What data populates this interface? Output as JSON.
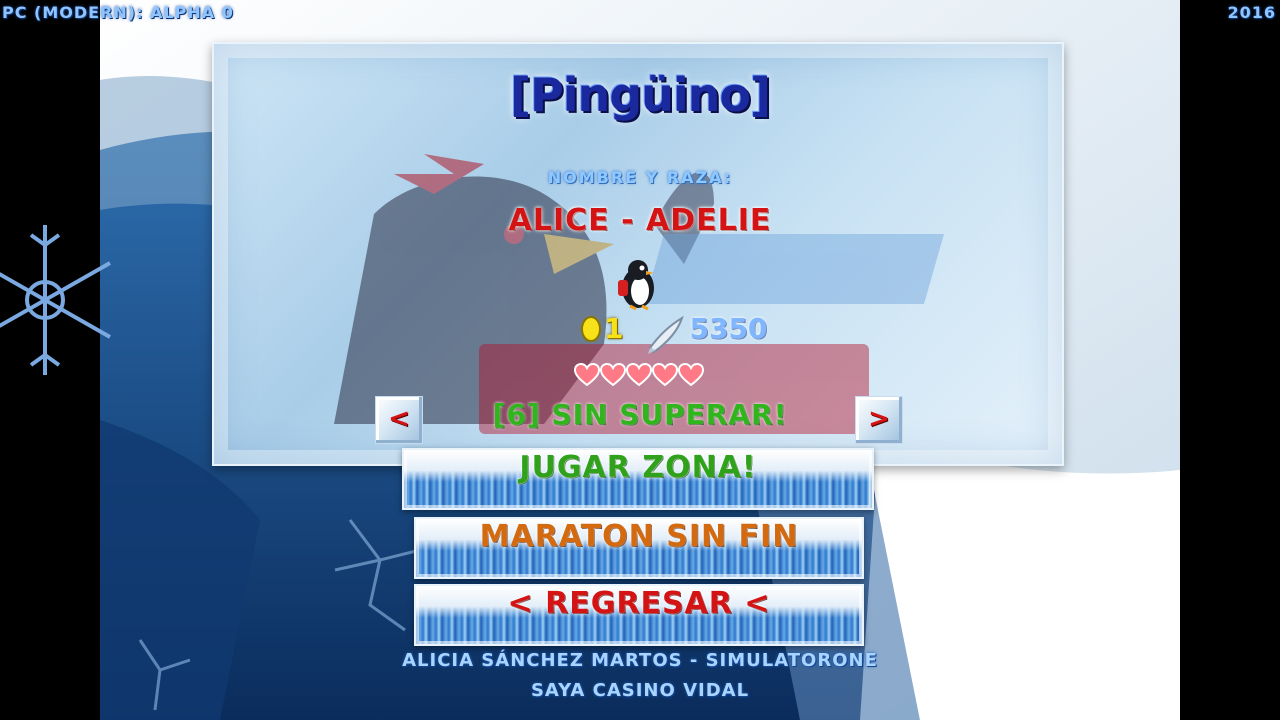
{
  "header": {
    "platform_label": "PC (MODERN): ALPHA 0",
    "year": "2016"
  },
  "panel": {
    "title": "[Pingüino]",
    "name_label": "NOMBRE Y RAZA:",
    "name_value": "ALICE - ADELIE",
    "eggs": "1",
    "fish": "5350",
    "lives": 5,
    "level_text": "[6] SIN SUPERAR!",
    "prev_label": "<",
    "next_label": ">"
  },
  "menu": {
    "play_label": "JUGAR ZONA!",
    "marathon_label": "MARATON SIN FIN",
    "back_label": "< REGRESAR <"
  },
  "credits": {
    "line1": "ALICIA SÁNCHEZ MARTOS - SIMULATORONE",
    "line2": "SAYA CASINO VIDAL"
  },
  "colors": {
    "title": "#1a2a9e",
    "name": "#d41414",
    "level": "#31b51c",
    "play": "#2fa11a",
    "marathon": "#d46a10",
    "back": "#d41414",
    "hud": "#8fc4ff"
  }
}
